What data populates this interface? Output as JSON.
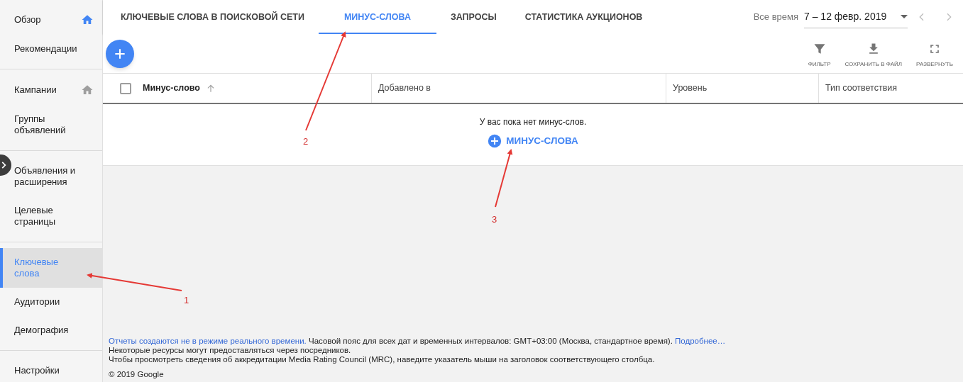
{
  "sidebar": {
    "groups": [
      [
        {
          "label": "Обзор",
          "selected": false,
          "icon": {
            "kind": "home",
            "highlighted": true
          }
        },
        {
          "label": "Рекомендации",
          "selected": false
        }
      ],
      [
        {
          "label": "Кампании",
          "selected": false,
          "icon": {
            "kind": "home",
            "highlighted": false
          }
        },
        {
          "label": "Группы объявлений",
          "selected": false
        }
      ],
      [
        {
          "label": "Объявления и расширения",
          "selected": false
        },
        {
          "label": "Целевые страницы",
          "selected": false
        }
      ],
      [
        {
          "label": "Ключевые слова",
          "selected": true
        },
        {
          "label": "Аудитории",
          "selected": false
        },
        {
          "label": "Демография",
          "selected": false
        }
      ],
      [
        {
          "label": "Настройки",
          "selected": false
        }
      ]
    ]
  },
  "tabs": [
    {
      "label": "КЛЮЧЕВЫЕ СЛОВА В ПОИСКОВОЙ СЕТИ",
      "selected": false
    },
    {
      "label": "МИНУС-СЛОВА",
      "selected": true
    },
    {
      "label": "ЗАПРОСЫ",
      "selected": false
    },
    {
      "label": "СТАТИСТИКА АУКЦИОНОВ",
      "selected": false
    }
  ],
  "date_range": {
    "preset": "Все время",
    "value": "7 – 12 февр. 2019"
  },
  "toolbar": [
    {
      "kind": "filter",
      "label": "ФИЛЬТР"
    },
    {
      "kind": "download",
      "label": "СОХРАНИТЬ В ФАЙЛ"
    },
    {
      "kind": "expand",
      "label": "РАЗВЕРНУТЬ"
    }
  ],
  "table": {
    "select_all": {
      "checked": false
    },
    "columns": [
      {
        "label": "Минус-слово",
        "sorted": true
      },
      {
        "label": "Добавлено в",
        "sorted": false
      },
      {
        "label": "Уровень",
        "sorted": false
      },
      {
        "label": "Тип соответствия",
        "sorted": false
      }
    ],
    "empty_message": "У вас пока нет минус-слов.",
    "add_button": "МИНУС-СЛОВА"
  },
  "footer": {
    "notice": {
      "link": "Отчеты создаются не в режиме реального времени.",
      "text": " Часовой пояс для всех дат и временных интервалов: GMT+03:00 (Москва, стандартное время). ",
      "more_link": "Подробнее…"
    },
    "lines": [
      "Некоторые ресурсы могут предоставляться через посредников.",
      "Чтобы просмотреть сведения об аккредитации Media Rating Council (MRC), наведите указатель мыши на заголовок соответствующего столбца."
    ],
    "copyright": "© 2019 Google"
  },
  "annotations": [
    {
      "label": "1"
    },
    {
      "label": "2"
    },
    {
      "label": "3"
    }
  ]
}
